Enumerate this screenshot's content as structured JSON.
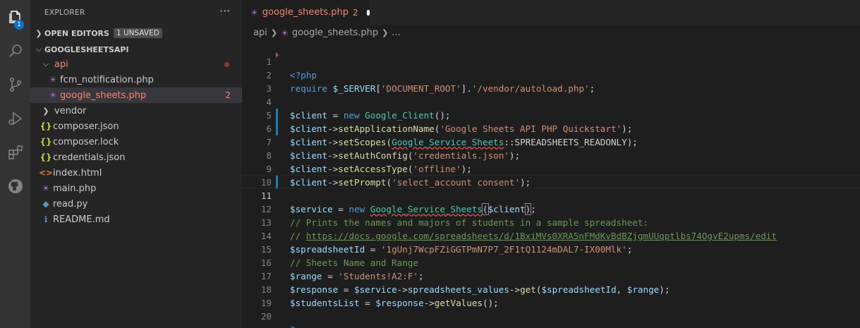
{
  "activity_bar": {
    "explorer_badge": "1",
    "icons": [
      "files-icon",
      "search-icon",
      "source-control-icon",
      "run-debug-icon",
      "extensions-icon",
      "github-icon"
    ]
  },
  "sidebar": {
    "title": "EXPLORER",
    "more": "···",
    "open_editors": {
      "label": "OPEN EDITORS",
      "badge": "1 UNSAVED"
    },
    "project": {
      "label": "GOOGLESHEETSAPI"
    },
    "tree": [
      {
        "label": "api",
        "kind": "folder-open"
      },
      {
        "label": "fcm_notification.php",
        "kind": "php"
      },
      {
        "label": "google_sheets.php",
        "kind": "php",
        "problems": "2"
      },
      {
        "label": "vendor",
        "kind": "folder"
      },
      {
        "label": "composer.json",
        "kind": "json"
      },
      {
        "label": "composer.lock",
        "kind": "json"
      },
      {
        "label": "credentials.json",
        "kind": "json"
      },
      {
        "label": "index.html",
        "kind": "html"
      },
      {
        "label": "main.php",
        "kind": "php"
      },
      {
        "label": "read.py",
        "kind": "python"
      },
      {
        "label": "README.md",
        "kind": "markdown"
      }
    ]
  },
  "editor": {
    "tab": {
      "label": "google_sheets.php",
      "problems": "2"
    },
    "breadcrumb": {
      "folder": "api",
      "file": "google_sheets.php",
      "more": "..."
    },
    "line_numbers": [
      "1",
      "2",
      "3",
      "4",
      "5",
      "6",
      "7",
      "8",
      "9",
      "10",
      "11",
      "12",
      "13",
      "14",
      "15",
      "16",
      "17",
      "18",
      "19",
      "20"
    ],
    "code": {
      "l1": {
        "a": "<?php"
      },
      "l2": {
        "a": "require",
        "b": " $_SERVER",
        "c": "[",
        "d": "'DOCUMENT_ROOT'",
        "e": "].",
        "f": "'/vendor/autoload.php'",
        "g": ";"
      },
      "l4": {
        "a": "$client",
        "b": " = ",
        "c": "new",
        "d": " ",
        "e": "Google_Client",
        "f": "();"
      },
      "l5": {
        "a": "$client",
        "b": "->",
        "c": "setApplicationName",
        "d": "(",
        "e": "'Google Sheets API PHP Quickstart'",
        "f": ");"
      },
      "l6": {
        "a": "$client",
        "b": "->",
        "c": "setScopes",
        "d": "(",
        "e": "Google_Service_Sheets",
        "f": "::SPREADSHEETS_READONLY);"
      },
      "l7": {
        "a": "$client",
        "b": "->",
        "c": "setAuthConfig",
        "d": "(",
        "e": "'credentials.json'",
        "f": ");"
      },
      "l8": {
        "a": "$client",
        "b": "->",
        "c": "setAccessType",
        "d": "(",
        "e": "'offline'",
        "f": ");"
      },
      "l9": {
        "a": "$client",
        "b": "->",
        "c": "setPrompt",
        "d": "(",
        "e": "'select_account consent'",
        "f": ");"
      },
      "l11": {
        "a": "$service",
        "b": " = ",
        "c": "new",
        "d": " ",
        "e": "Google_Service_Sheets",
        "f": "(",
        "g": "$client",
        "h": ")",
        "i": ";"
      },
      "l12": {
        "a": "// Prints the names and majors of students in a sample spreadsheet:"
      },
      "l13": {
        "a": "// ",
        "b": "https://docs.google.com/spreadsheets/d/1BxiMVs0XRA5nFMdKvBdBZjgmUUqptlbs74OgvE2upms/edit"
      },
      "l14": {
        "a": "$spreadsheetId",
        "b": " = ",
        "c": "'1gUnj7WcpFZiGGTPmN7P7_2F1tQ1124mDAL7-IX00Mlk'",
        "d": ";"
      },
      "l15": {
        "a": "// Sheets Name and Range"
      },
      "l16": {
        "a": "$range",
        "b": " = ",
        "c": "'Students!A2:F'",
        "d": ";"
      },
      "l17": {
        "a": "$response",
        "b": " = ",
        "c": "$service",
        "d": "->",
        "e": "spreadsheets_values",
        "f": "->",
        "g": "get",
        "h": "(",
        "i": "$spreadsheetId",
        "j": ", ",
        "k": "$range",
        "l": ");"
      },
      "l18": {
        "a": "$studentsList",
        "b": " = ",
        "c": "$response",
        "d": "->",
        "e": "getValues",
        "f": "();"
      },
      "l20": {
        "a": "?>"
      }
    }
  },
  "colors": {
    "activity_bar": "#333333",
    "sidebar": "#252526",
    "editor": "#1e1e1e",
    "keyword": "#569cd6",
    "variable": "#9cdcfe",
    "function": "#dcdcaa",
    "string": "#ce9178",
    "comment": "#6a9955",
    "class": "#4ec9b0",
    "error": "#f48771"
  }
}
